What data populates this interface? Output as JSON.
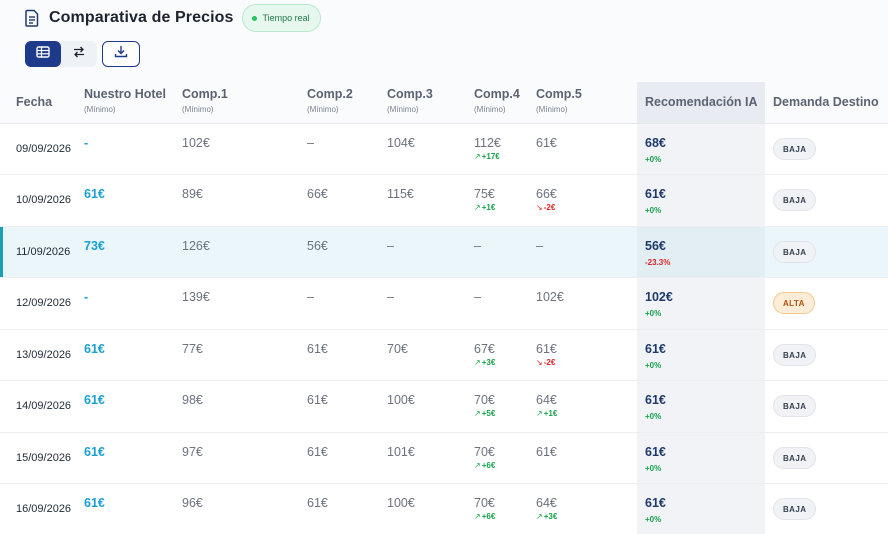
{
  "header": {
    "title": "Comparativa de Precios",
    "live_badge": "Tiempo real"
  },
  "toolbar": {
    "views": [
      {
        "icon": "table-icon",
        "active": true
      },
      {
        "icon": "swap-icon",
        "active": false
      }
    ],
    "download_icon": "download-icon"
  },
  "columns": {
    "fecha": "Fecha",
    "hotel": "Nuestro Hotel",
    "hotel_sub": "(Mínimo)",
    "comp1": "Comp.1",
    "comp1_sub": "(Mínimo)",
    "comp2": "Comp.2",
    "comp2_sub": "(Mínimo)",
    "comp3": "Comp.3",
    "comp3_sub": "(Mínimo)",
    "comp4": "Comp.4",
    "comp4_sub": "(Mínimo)",
    "comp5": "Comp.5",
    "comp5_sub": "(Mínimo)",
    "reco": "Recomendación IA",
    "demanda": "Demanda Destino"
  },
  "rows": [
    {
      "fecha": "09/09/2026",
      "hotel": "-",
      "c1": "102€",
      "c2": "–",
      "c3": "104€",
      "c4": "112€",
      "c4_delta": "+17€",
      "c4_dir": "up",
      "c5": "61€",
      "c5_delta": "",
      "c5_dir": "",
      "reco": "68€",
      "reco_pct": "+0%",
      "reco_dir": "pos",
      "demanda": "BAJA",
      "demanda_level": "baja",
      "selected": false
    },
    {
      "fecha": "10/09/2026",
      "hotel": "61€",
      "c1": "89€",
      "c2": "66€",
      "c3": "115€",
      "c4": "75€",
      "c4_delta": "+1€",
      "c4_dir": "up",
      "c5": "66€",
      "c5_delta": "-2€",
      "c5_dir": "down",
      "reco": "61€",
      "reco_pct": "+0%",
      "reco_dir": "pos",
      "demanda": "BAJA",
      "demanda_level": "baja",
      "selected": false
    },
    {
      "fecha": "11/09/2026",
      "hotel": "73€",
      "c1": "126€",
      "c2": "56€",
      "c3": "–",
      "c4": "–",
      "c4_delta": "",
      "c4_dir": "",
      "c5": "–",
      "c5_delta": "",
      "c5_dir": "",
      "reco": "56€",
      "reco_pct": "-23.3%",
      "reco_dir": "neg",
      "demanda": "BAJA",
      "demanda_level": "baja",
      "selected": true
    },
    {
      "fecha": "12/09/2026",
      "hotel": "-",
      "c1": "139€",
      "c2": "–",
      "c3": "–",
      "c4": "–",
      "c4_delta": "",
      "c4_dir": "",
      "c5": "102€",
      "c5_delta": "",
      "c5_dir": "",
      "reco": "102€",
      "reco_pct": "+0%",
      "reco_dir": "pos",
      "demanda": "ALTA",
      "demanda_level": "alta",
      "selected": false
    },
    {
      "fecha": "13/09/2026",
      "hotel": "61€",
      "c1": "77€",
      "c2": "61€",
      "c3": "70€",
      "c4": "67€",
      "c4_delta": "+3€",
      "c4_dir": "up",
      "c5": "61€",
      "c5_delta": "-2€",
      "c5_dir": "down",
      "reco": "61€",
      "reco_pct": "+0%",
      "reco_dir": "pos",
      "demanda": "BAJA",
      "demanda_level": "baja",
      "selected": false
    },
    {
      "fecha": "14/09/2026",
      "hotel": "61€",
      "c1": "98€",
      "c2": "61€",
      "c3": "100€",
      "c4": "70€",
      "c4_delta": "+5€",
      "c4_dir": "up",
      "c5": "64€",
      "c5_delta": "+1€",
      "c5_dir": "up",
      "reco": "61€",
      "reco_pct": "+0%",
      "reco_dir": "pos",
      "demanda": "BAJA",
      "demanda_level": "baja",
      "selected": false
    },
    {
      "fecha": "15/09/2026",
      "hotel": "61€",
      "c1": "97€",
      "c2": "61€",
      "c3": "101€",
      "c4": "70€",
      "c4_delta": "+6€",
      "c4_dir": "up",
      "c5": "61€",
      "c5_delta": "",
      "c5_dir": "",
      "reco": "61€",
      "reco_pct": "+0%",
      "reco_dir": "pos",
      "demanda": "BAJA",
      "demanda_level": "baja",
      "selected": false
    },
    {
      "fecha": "16/09/2026",
      "hotel": "61€",
      "c1": "96€",
      "c2": "61€",
      "c3": "100€",
      "c4": "70€",
      "c4_delta": "+6€",
      "c4_dir": "up",
      "c5": "64€",
      "c5_delta": "+3€",
      "c5_dir": "up",
      "reco": "61€",
      "reco_pct": "+0%",
      "reco_dir": "pos",
      "demanda": "BAJA",
      "demanda_level": "baja",
      "selected": false
    }
  ]
}
